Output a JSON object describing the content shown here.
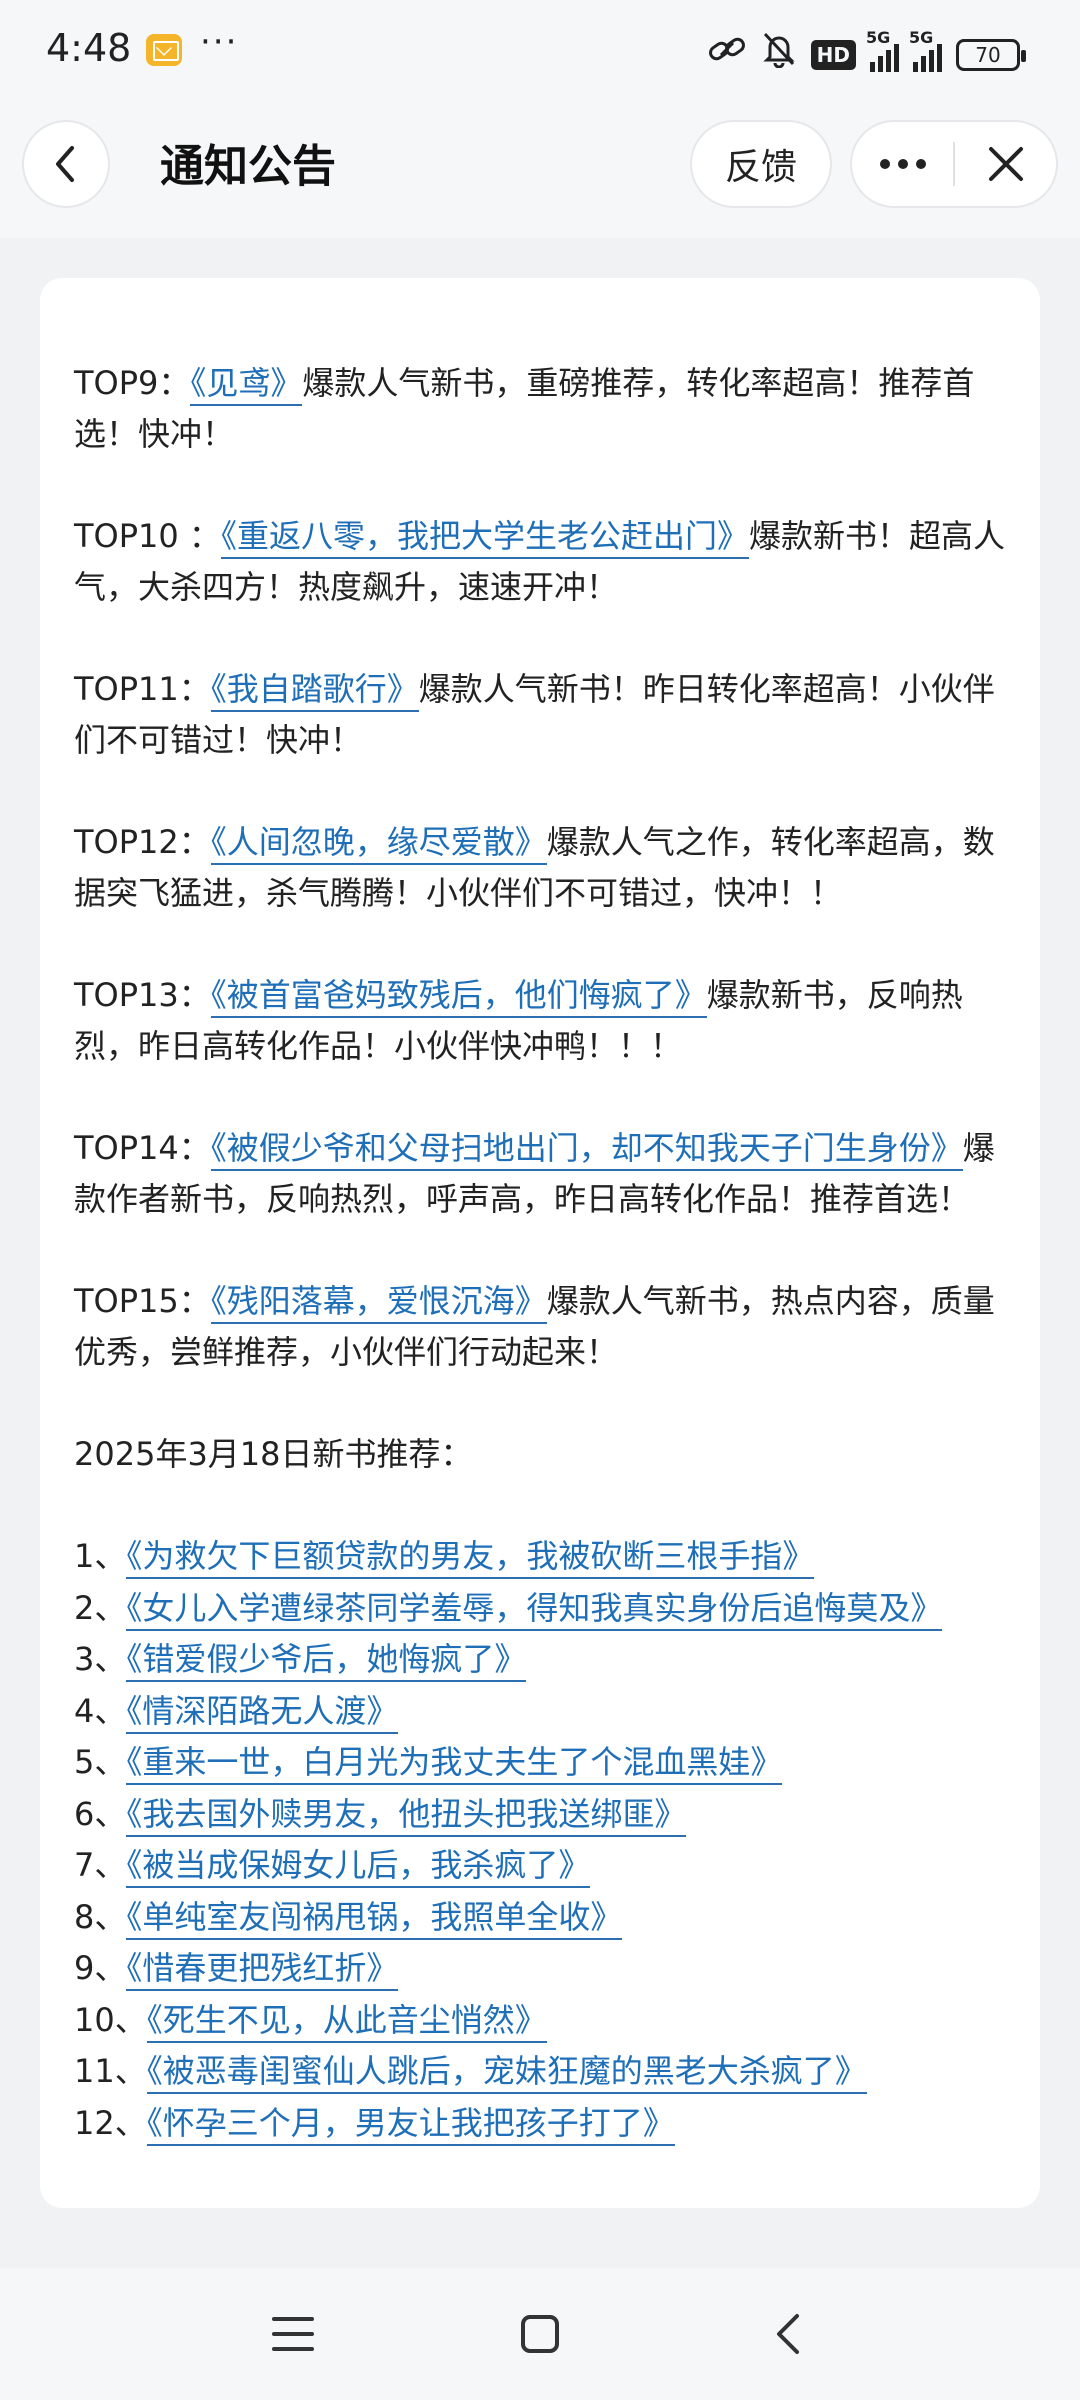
{
  "status_bar": {
    "time": "4:48",
    "more": "···",
    "hd": "HD",
    "net1": "5G",
    "net2": "5G",
    "battery": "70"
  },
  "header": {
    "title": "通知公告",
    "feedback_label": "反馈"
  },
  "entries": [
    {
      "rank": "TOP9：",
      "book": "《见鸢》",
      "desc": "爆款人气新书，重磅推荐，转化率超高！推荐首选！快冲！"
    },
    {
      "rank": "TOP10 ：",
      "book": "《重返八零，我把大学生老公赶出门》",
      "desc": "爆款新书！超高人气，大杀四方！热度飙升，速速开冲！"
    },
    {
      "rank": "TOP11：",
      "book": "《我自踏歌行》",
      "desc": "爆款人气新书！昨日转化率超高！小伙伴们不可错过！快冲！"
    },
    {
      "rank": "TOP12：",
      "book": "《人间忽晚，缘尽爱散》",
      "desc": "爆款人气之作，转化率超高，数据突飞猛进，杀气腾腾！小伙伴们不可错过，快冲！！"
    },
    {
      "rank": "TOP13：",
      "book": "《被首富爸妈致残后，他们悔疯了》",
      "desc": "爆款新书，反响热烈，昨日高转化作品！小伙伴快冲鸭！！！"
    },
    {
      "rank": "TOP14：",
      "book": "《被假少爷和父母扫地出门，却不知我天子门生身份》",
      "desc": "爆款作者新书，反响热烈，呼声高，昨日高转化作品！推荐首选！"
    },
    {
      "rank": "TOP15：",
      "book": "《残阳落幕，爱恨沉海》",
      "desc": "爆款人气新书，热点内容，质量优秀，尝鲜推荐，小伙伴们行动起来！"
    }
  ],
  "recommend": {
    "date_line": "2025年3月18日新书推荐：",
    "items": [
      {
        "num": "1、",
        "book": "《为救欠下巨额贷款的男友，我被砍断三根手指》"
      },
      {
        "num": "2、",
        "book": "《女儿入学遭绿茶同学羞辱，得知我真实身份后追悔莫及》"
      },
      {
        "num": "3、",
        "book": "《错爱假少爷后，她悔疯了》"
      },
      {
        "num": "4、",
        "book": "《情深陌路无人渡》"
      },
      {
        "num": "5、",
        "book": "《重来一世，白月光为我丈夫生了个混血黑娃》"
      },
      {
        "num": "6、",
        "book": "《我去国外赎男友，他扭头把我送绑匪》"
      },
      {
        "num": "7、",
        "book": "《被当成保姆女儿后，我杀疯了》"
      },
      {
        "num": "8、",
        "book": "《单纯室友闯祸甩锅，我照单全收》"
      },
      {
        "num": "9、",
        "book": "《惜春更把残红折》"
      },
      {
        "num": "10、",
        "book": "《死生不见，从此音尘悄然》"
      },
      {
        "num": "11、",
        "book": "《被恶毒闺蜜仙人跳后，宠妹狂魔的黑老大杀疯了》"
      },
      {
        "num": "12、",
        "book": "《怀孕三个月，男友让我把孩子打了》"
      }
    ]
  },
  "colors": {
    "link": "#1f6fb8",
    "background": "#f1f2f4",
    "card": "#ffffff",
    "mail_icon": "#f5b52a"
  },
  "icons": {
    "back": "chevron-left-icon",
    "more": "more-dots-icon",
    "close": "close-icon",
    "nav_menu": "menu-icon",
    "nav_home": "home-square-icon",
    "nav_back": "back-triangle-icon"
  }
}
